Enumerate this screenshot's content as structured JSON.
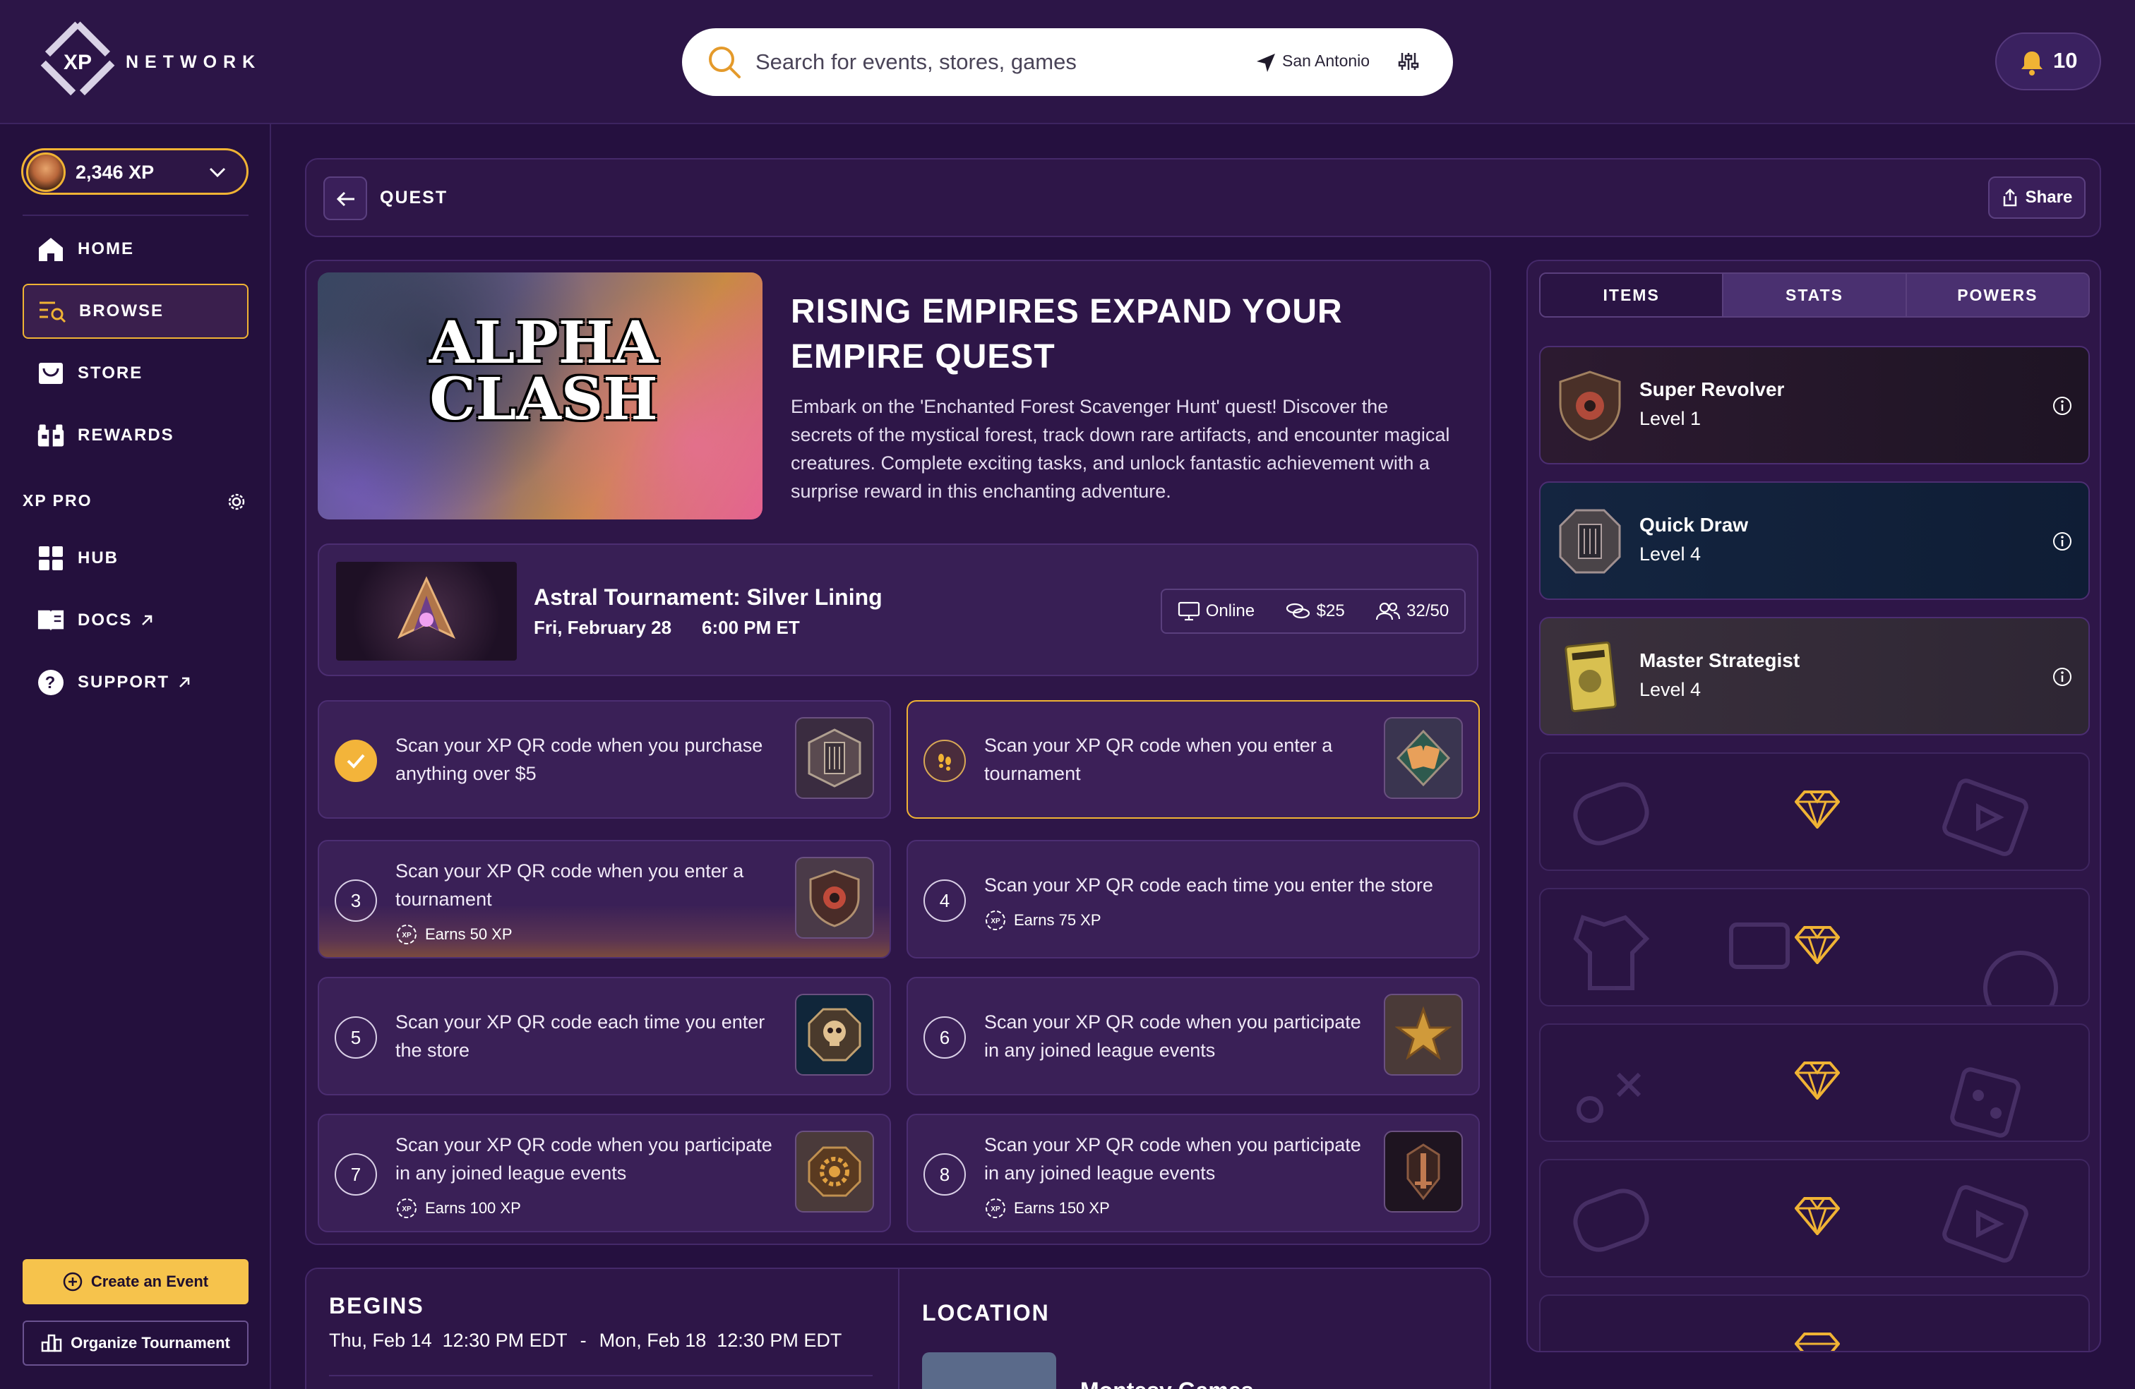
{
  "brand": {
    "logo_text": "XP",
    "name": "NETWORK"
  },
  "search": {
    "placeholder": "Search for events, stores, games",
    "location": "San Antonio"
  },
  "notifications": {
    "count": "10"
  },
  "user": {
    "xp": "2,346 XP"
  },
  "nav": {
    "items": [
      {
        "label": "HOME",
        "icon": "home-icon"
      },
      {
        "label": "BROWSE",
        "icon": "browse-icon"
      },
      {
        "label": "STORE",
        "icon": "store-icon"
      },
      {
        "label": "REWARDS",
        "icon": "rewards-icon"
      }
    ],
    "pro_label": "XP PRO",
    "pro_items": [
      {
        "label": "HUB",
        "icon": "grid-icon"
      },
      {
        "label": "DOCS",
        "icon": "book-icon"
      },
      {
        "label": "SUPPORT",
        "icon": "question-icon"
      }
    ],
    "create_event": "Create an Event",
    "organize_tournament": "Organize Tournament"
  },
  "quest_bar": {
    "label": "QUEST",
    "share": "Share"
  },
  "quest": {
    "hero_art_text": "ALPHA CLASH",
    "title": "RISING EMPIRES EXPAND YOUR EMPIRE QUEST",
    "description": "Embark on the 'Enchanted Forest Scavenger Hunt' quest! Discover the secrets of the mystical forest, track down rare artifacts, and encounter magical creatures. Complete exciting tasks, and unlock fantastic achievement with a surprise reward in this enchanting adventure."
  },
  "event": {
    "title": "Astral Tournament: Silver Lining",
    "date": "Fri, February 28",
    "time": "6:00 PM ET",
    "mode": "Online",
    "price": "$25",
    "capacity": "32/50"
  },
  "tasks": [
    {
      "num": "",
      "state": "done",
      "text": "Scan your XP QR code when you purchase anything over $5",
      "earn": ""
    },
    {
      "num": "",
      "state": "active",
      "text": "Scan your XP QR code when you enter a tournament",
      "earn": ""
    },
    {
      "num": "3",
      "state": "todo",
      "text": "Scan your XP QR code when you enter a tournament",
      "earn": "Earns 50 XP"
    },
    {
      "num": "4",
      "state": "todo",
      "text": "Scan your XP QR code each time you enter the store",
      "earn": "Earns 75 XP"
    },
    {
      "num": "5",
      "state": "todo",
      "text": "Scan your XP QR code each time you enter the store",
      "earn": ""
    },
    {
      "num": "6",
      "state": "todo",
      "text": "Scan your XP QR code when you participate in any joined league events",
      "earn": ""
    },
    {
      "num": "7",
      "state": "todo",
      "text": "Scan your XP QR code when you participate in any joined league events",
      "earn": "Earns 100 XP"
    },
    {
      "num": "8",
      "state": "todo",
      "text": "Scan your XP QR code when you participate in any joined league events",
      "earn": "Earns 150 XP"
    }
  ],
  "schedule": {
    "begins_label": "BEGINS",
    "start": "Thu, Feb 14  12:30 PM EDT",
    "separator": "-",
    "end": "Mon, Feb 18  12:30 PM EDT",
    "location_label": "LOCATION",
    "location_name": "Montesy Games"
  },
  "inventory": {
    "tabs": [
      "ITEMS",
      "STATS",
      "POWERS"
    ],
    "items": [
      {
        "name": "Super Revolver",
        "level": "Level 1",
        "icon": "shield-badge-icon",
        "bg": "#2a1a2e"
      },
      {
        "name": "Quick Draw",
        "level": "Level 4",
        "icon": "octagon-badge-icon",
        "bg": "#16244a"
      },
      {
        "name": "Master Strategist",
        "level": "Level 4",
        "icon": "card-badge-icon",
        "bg": "#3a2e3e"
      }
    ],
    "empty_slot_icon": "gem-icon"
  },
  "colors": {
    "accent": "#f0b334",
    "background": "#25103f",
    "panel": "#2e1648"
  }
}
